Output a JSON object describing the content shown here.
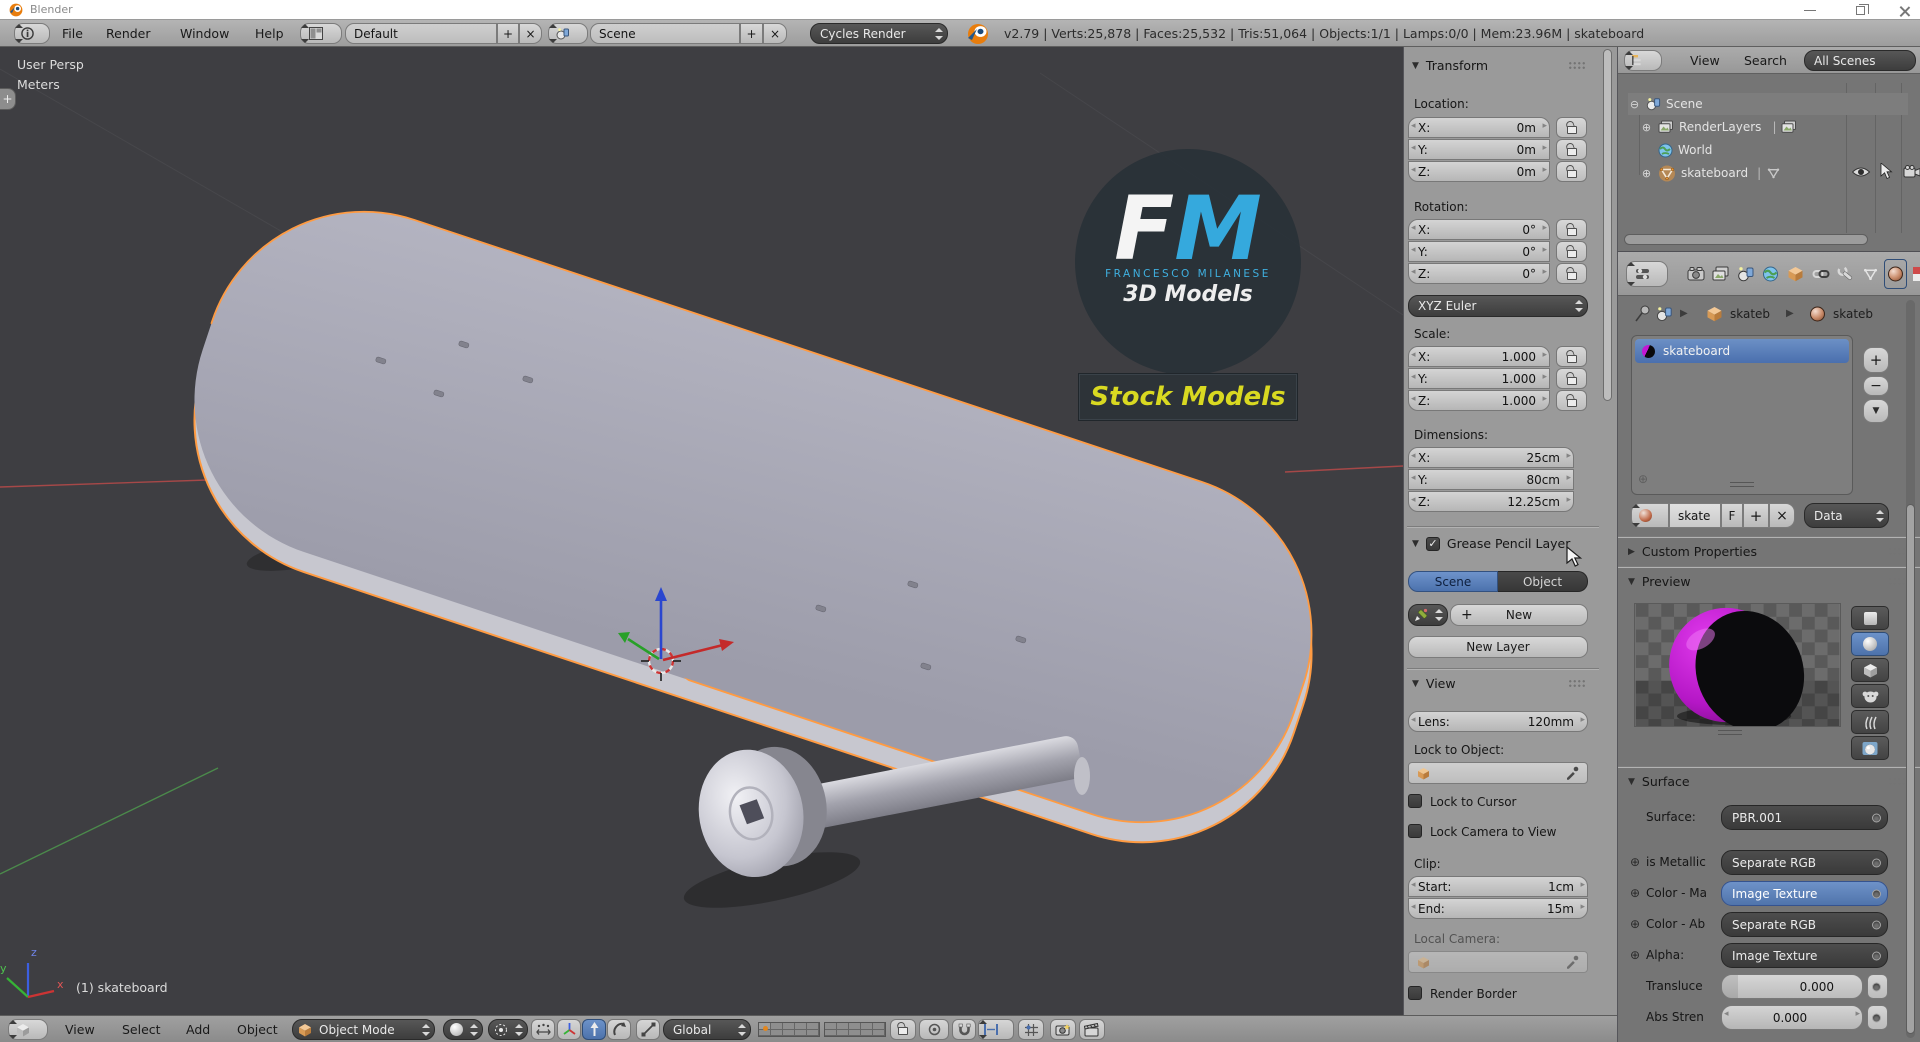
{
  "window": {
    "title": "Blender"
  },
  "infobar": {
    "menus": [
      "File",
      "Render",
      "Window",
      "Help"
    ],
    "layout_name": "Default",
    "scene_name": "Scene",
    "engine": "Cycles Render",
    "stats": "v2.79 | Verts:25,878 | Faces:25,532 | Tris:51,064 | Objects:1/1 | Lamps:0/0 | Mem:23.96M | skateboard"
  },
  "viewport": {
    "view_label": "User Persp",
    "units_label": "Meters",
    "object_info": "(1) skateboard",
    "axis_x": "x",
    "axis_y": "y",
    "axis_z": "z",
    "watermark": {
      "f": "F",
      "m": "M",
      "name": "FRANCESCO MILANESE",
      "models": "3D Models",
      "badge": "Stock Models"
    }
  },
  "npanel": {
    "transform_title": "Transform",
    "location_label": "Location:",
    "loc": [
      {
        "axis": "X:",
        "value": "0m"
      },
      {
        "axis": "Y:",
        "value": "0m"
      },
      {
        "axis": "Z:",
        "value": "0m"
      }
    ],
    "rotation_label": "Rotation:",
    "rot": [
      {
        "axis": "X:",
        "value": "0°"
      },
      {
        "axis": "Y:",
        "value": "0°"
      },
      {
        "axis": "Z:",
        "value": "0°"
      }
    ],
    "rotation_mode": "XYZ Euler",
    "scale_label": "Scale:",
    "scl": [
      {
        "axis": "X:",
        "value": "1.000"
      },
      {
        "axis": "Y:",
        "value": "1.000"
      },
      {
        "axis": "Z:",
        "value": "1.000"
      }
    ],
    "dimensions_label": "Dimensions:",
    "dim": [
      {
        "axis": "X:",
        "value": "25cm"
      },
      {
        "axis": "Y:",
        "value": "80cm"
      },
      {
        "axis": "Z:",
        "value": "12.25cm"
      }
    ],
    "grease_title": "Grease Pencil Layer",
    "grease_tabs": [
      "Scene",
      "Object"
    ],
    "new_button": "New",
    "new_layer_button": "New Layer",
    "view_title": "View",
    "lens_label": "Lens:",
    "lens_value": "120mm",
    "lock_to_object_label": "Lock to Object:",
    "lock_to_cursor_label": "Lock to Cursor",
    "lock_camera_label": "Lock Camera to View",
    "clip_label": "Clip:",
    "clip_start_label": "Start:",
    "clip_start_value": "1cm",
    "clip_end_label": "End:",
    "clip_end_value": "15m",
    "local_camera_label": "Local Camera:",
    "render_border_label": "Render Border"
  },
  "outliner": {
    "menus": [
      "View",
      "Search"
    ],
    "display_mode": "All Scenes",
    "scene": "Scene",
    "render_layers": "RenderLayers",
    "world": "World",
    "object": "skateboard"
  },
  "properties": {
    "breadcrumb_object": "skateb",
    "breadcrumb_material": "skateb",
    "material_slot": "skateboard",
    "name_field": "skate",
    "fake_user": "F",
    "data_source": "Data",
    "custom_properties_title": "Custom Properties",
    "preview_title": "Preview",
    "surface_title": "Surface",
    "rows": [
      {
        "label": "Surface:",
        "value": "PBR.001"
      },
      {
        "label": "is Metallic",
        "value": "Separate RGB"
      },
      {
        "label": "Color - Ma",
        "value": "Image Texture"
      },
      {
        "label": "Color - Ab",
        "value": "Separate RGB"
      },
      {
        "label": "Alpha:",
        "value": "Image Texture"
      },
      {
        "label": "Transluce",
        "value": "0.000"
      },
      {
        "label": "Abs Stren",
        "value": "0.000"
      }
    ]
  },
  "toolbar": {
    "menus": [
      "View",
      "Select",
      "Add",
      "Object"
    ],
    "mode": "Object Mode",
    "orientation": "Global"
  },
  "glyphs": {
    "plus": "+",
    "close": "×",
    "minus": "−",
    "down_tri": "▼",
    "right_tri": "▶",
    "bar": "|",
    "check": "✓",
    "circle_plus": "⊕",
    "circle_minus": "⊖"
  },
  "colors": {
    "accent_blue": "#5680c2",
    "selection_orange": "#ff9b42",
    "viewport_bg": "#3e3e42",
    "fm_blue": "#35a9dd",
    "stock_yellow": "#d9d921",
    "material_magenta": "#c217d4"
  }
}
